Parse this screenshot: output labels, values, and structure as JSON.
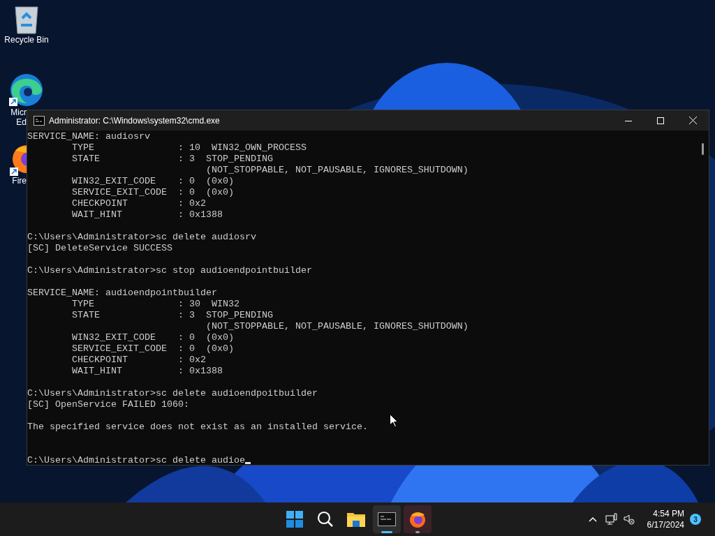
{
  "desktop_icons": [
    {
      "kind": "recycle",
      "lines": [
        "Recycle Bin"
      ]
    },
    {
      "kind": "edge",
      "lines": [
        "Micr",
        "Ed"
      ]
    },
    {
      "kind": "firefox",
      "lines": [
        "Fire"
      ]
    }
  ],
  "window": {
    "title": "Administrator: C:\\Windows\\system32\\cmd.exe"
  },
  "console": {
    "cursor_visible": true,
    "lines": [
      {
        "kind": "text",
        "text": "SERVICE_NAME: audiosrv"
      },
      {
        "kind": "text",
        "text": "        TYPE               : 10  WIN32_OWN_PROCESS"
      },
      {
        "kind": "text",
        "text": "        STATE              : 3  STOP_PENDING"
      },
      {
        "kind": "text",
        "text": "                                (NOT_STOPPABLE, NOT_PAUSABLE, IGNORES_SHUTDOWN)"
      },
      {
        "kind": "text",
        "text": "        WIN32_EXIT_CODE    : 0  (0x0)"
      },
      {
        "kind": "text",
        "text": "        SERVICE_EXIT_CODE  : 0  (0x0)"
      },
      {
        "kind": "text",
        "text": "        CHECKPOINT         : 0x2"
      },
      {
        "kind": "text",
        "text": "        WAIT_HINT          : 0x1388"
      },
      {
        "kind": "blank"
      },
      {
        "kind": "text",
        "text": "C:\\Users\\Administrator>sc delete audiosrv"
      },
      {
        "kind": "text",
        "text": "[SC] DeleteService SUCCESS"
      },
      {
        "kind": "blank"
      },
      {
        "kind": "text",
        "text": "C:\\Users\\Administrator>sc stop audioendpointbuilder"
      },
      {
        "kind": "blank"
      },
      {
        "kind": "text",
        "text": "SERVICE_NAME: audioendpointbuilder"
      },
      {
        "kind": "text",
        "text": "        TYPE               : 30  WIN32"
      },
      {
        "kind": "text",
        "text": "        STATE              : 3  STOP_PENDING"
      },
      {
        "kind": "text",
        "text": "                                (NOT_STOPPABLE, NOT_PAUSABLE, IGNORES_SHUTDOWN)"
      },
      {
        "kind": "text",
        "text": "        WIN32_EXIT_CODE    : 0  (0x0)"
      },
      {
        "kind": "text",
        "text": "        SERVICE_EXIT_CODE  : 0  (0x0)"
      },
      {
        "kind": "text",
        "text": "        CHECKPOINT         : 0x2"
      },
      {
        "kind": "text",
        "text": "        WAIT_HINT          : 0x1388"
      },
      {
        "kind": "blank"
      },
      {
        "kind": "text",
        "text": "C:\\Users\\Administrator>sc delete audioendpoitbuilder"
      },
      {
        "kind": "text",
        "text": "[SC] OpenService FAILED 1060:"
      },
      {
        "kind": "blank"
      },
      {
        "kind": "text",
        "text": "The specified service does not exist as an installed service."
      },
      {
        "kind": "blank"
      },
      {
        "kind": "blank"
      },
      {
        "kind": "text",
        "text": "C:\\Users\\Administrator>sc delete audioe"
      }
    ]
  },
  "taskbar": {
    "apps": [
      {
        "kind": "start",
        "selected": false,
        "running": false
      },
      {
        "kind": "search",
        "selected": false,
        "running": false
      },
      {
        "kind": "explorer",
        "selected": false,
        "running": false
      },
      {
        "kind": "terminal",
        "selected": true,
        "running": true
      },
      {
        "kind": "firefox",
        "selected": false,
        "running": true
      }
    ],
    "clock": {
      "time": "4:54 PM",
      "date": "6/17/2024"
    },
    "notifications": "3"
  }
}
